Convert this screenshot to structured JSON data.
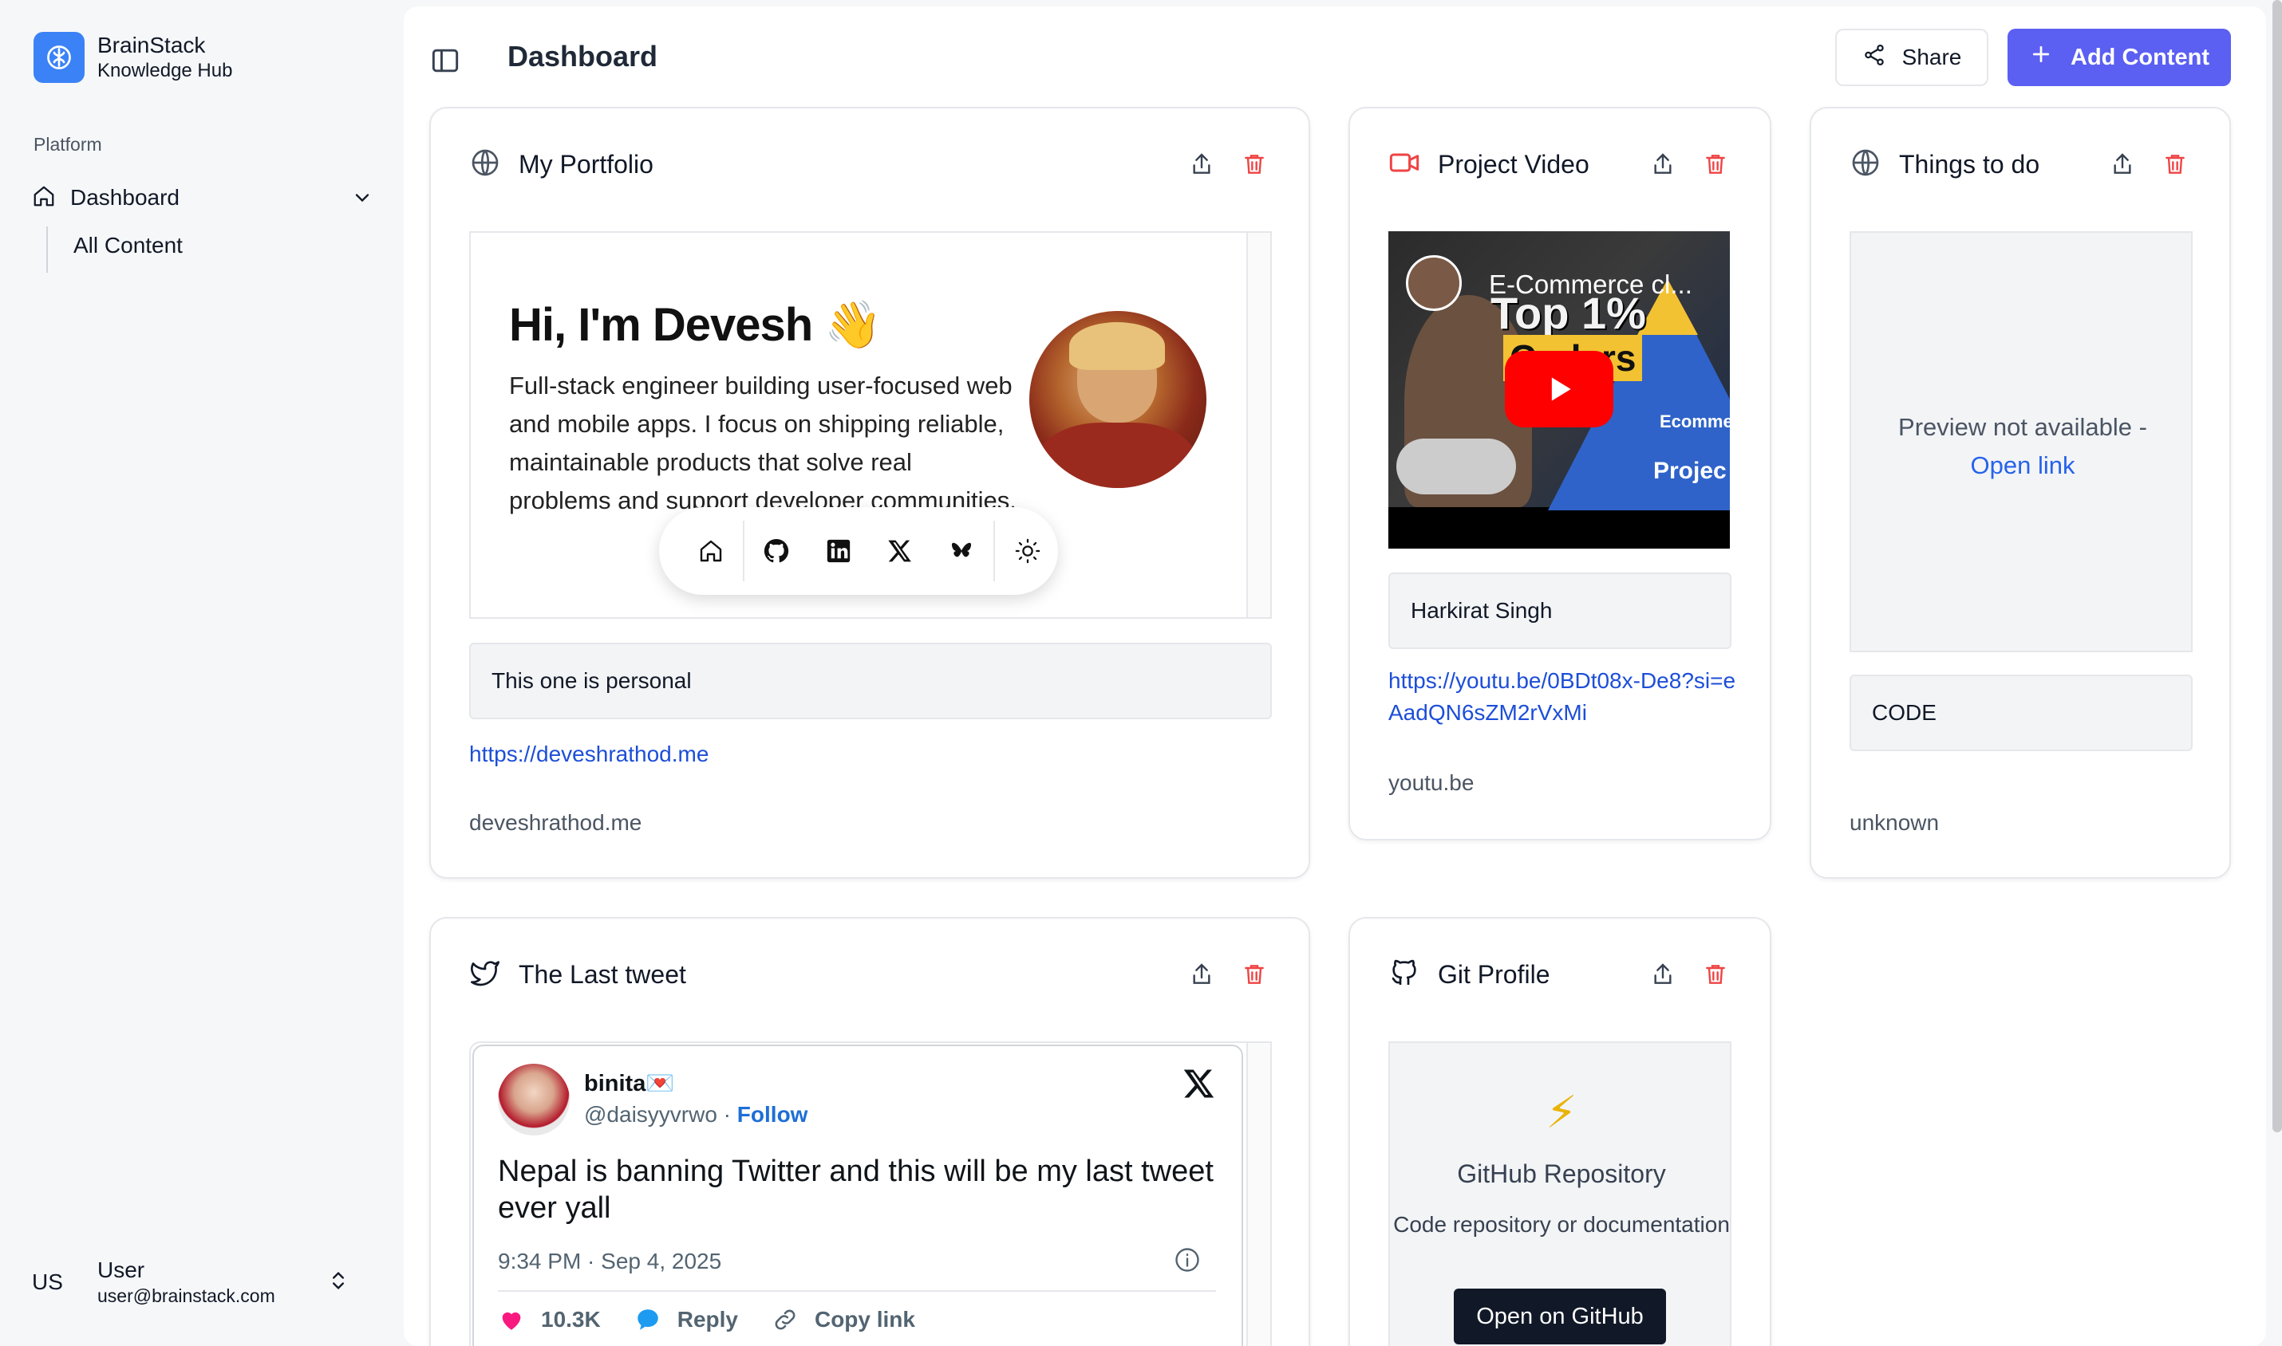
{
  "brand": {
    "name": "BrainStack",
    "subtitle": "Knowledge Hub"
  },
  "sidebar": {
    "section_label": "Platform",
    "nav": {
      "label": "Dashboard",
      "icon": "home-icon"
    },
    "sub_items": [
      {
        "label": "All Content"
      }
    ]
  },
  "user": {
    "initials": "US",
    "name": "User",
    "email": "user@brainstack.com"
  },
  "header": {
    "title": "Dashboard",
    "share_label": "Share",
    "add_label": "Add Content"
  },
  "colors": {
    "accent": "#5b5ff2",
    "brand": "#3b82f6",
    "danger": "#ef4444",
    "link": "#1d4ed8"
  },
  "cards": {
    "portfolio": {
      "title": "My Portfolio",
      "icon": "globe-icon",
      "preview": {
        "heading": "Hi, I'm Devesh 👋",
        "bio": "Full-stack engineer building user-focused web and mobile apps. I focus on shipping reliable, maintainable products that solve real problems and support developer communities.",
        "dock_icons": [
          "home-icon",
          "github-icon",
          "linkedin-icon",
          "x-icon",
          "bluesky-icon",
          "sun-icon"
        ]
      },
      "note": "This one is personal",
      "url": "https://deveshrathod.me",
      "domain": "deveshrathod.me"
    },
    "video": {
      "title": "Project Video",
      "icon": "video-icon",
      "thumbnail": {
        "video_title": "E-Commerce cl...",
        "overlay_top": "Top 1%",
        "overlay_coders": "Coders",
        "overlay_ecom": "Ecomme",
        "overlay_proj": "Projec"
      },
      "note": "Harkirat Singh",
      "url": "https://youtu.be/0BDt08x-De8?si=eAadQN6sZM2rVxMi",
      "domain": "youtu.be"
    },
    "todo": {
      "title": "Things to do",
      "icon": "globe-icon",
      "preview_text": "Preview not available -",
      "preview_link": "Open link",
      "note": "CODE",
      "domain": "unknown"
    },
    "tweet": {
      "title": "The Last tweet",
      "icon": "twitter-icon",
      "author": "binita💌",
      "handle": "@daisyyvrwo",
      "follow": "Follow",
      "text": "Nepal is banning Twitter and this will be my last tweet ever yall",
      "time": "9:34 PM · Sep 4, 2025",
      "likes": "10.3K",
      "reply": "Reply",
      "copy": "Copy link"
    },
    "git": {
      "title": "Git Profile",
      "icon": "github-icon",
      "repo_title": "GitHub Repository",
      "repo_desc": "Code repository or documentation",
      "button": "Open on GitHub"
    }
  }
}
